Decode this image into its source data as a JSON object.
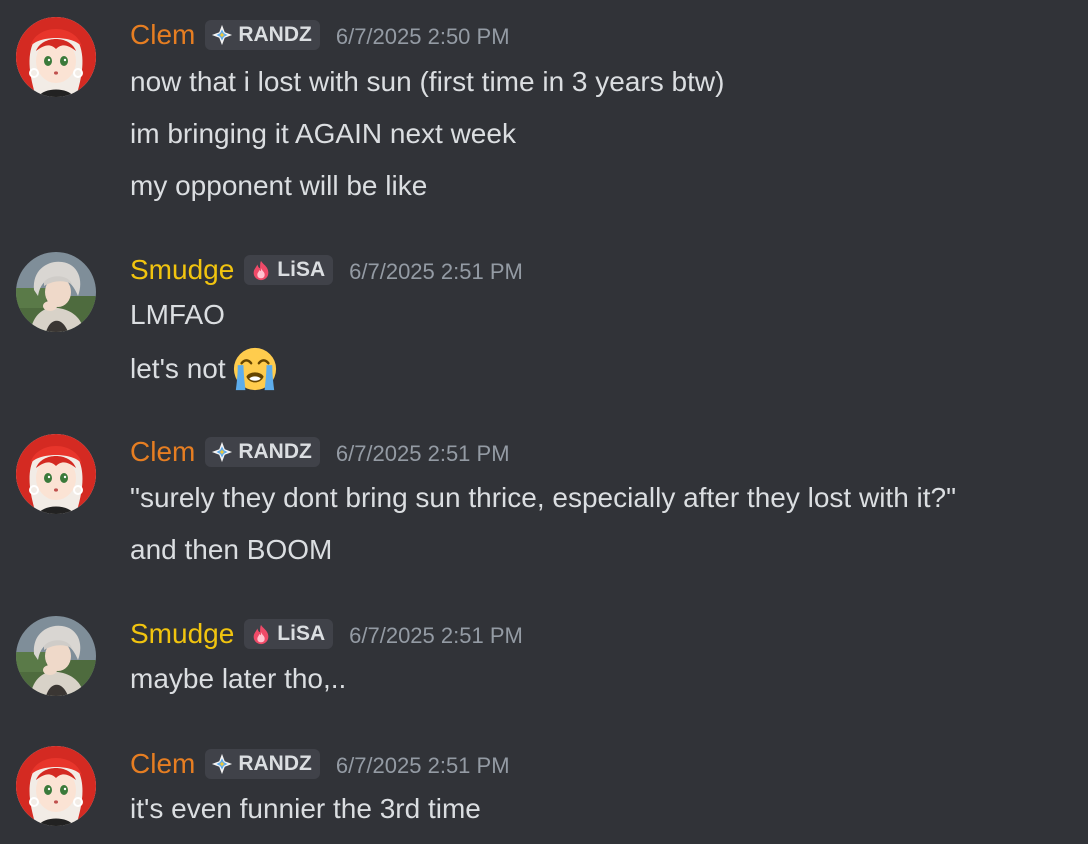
{
  "colors": {
    "background": "#313338",
    "clem_name": "#e67e22",
    "smudge_name": "#f1c40f",
    "text": "#dbdee1",
    "timestamp": "#949ba4",
    "tag_bg": "#404249"
  },
  "messages": [
    {
      "author": "Clem",
      "tag": "RANDZ",
      "tag_icon": "diamond-sparkle-icon",
      "timestamp": "6/7/2025 2:50 PM",
      "lines": [
        "now that i lost with sun (first time in 3 years btw)",
        "im bringing it AGAIN next week",
        "my opponent will be like"
      ]
    },
    {
      "author": "Smudge",
      "tag": "LiSA",
      "tag_icon": "flame-icon",
      "timestamp": "6/7/2025 2:51 PM",
      "lines": [
        "LMFAO",
        "let's not"
      ],
      "emoji": "loudly-crying-face-emoji"
    },
    {
      "author": "Clem",
      "tag": "RANDZ",
      "tag_icon": "diamond-sparkle-icon",
      "timestamp": "6/7/2025 2:51 PM",
      "lines": [
        "\"surely they dont bring sun thrice, especially after they lost with it?\"",
        "and then BOOM"
      ]
    },
    {
      "author": "Smudge",
      "tag": "LiSA",
      "tag_icon": "flame-icon",
      "timestamp": "6/7/2025 2:51 PM",
      "lines": [
        "maybe later tho,.."
      ]
    },
    {
      "author": "Clem",
      "tag": "RANDZ",
      "tag_icon": "diamond-sparkle-icon",
      "timestamp": "6/7/2025 2:51 PM",
      "lines": [
        "it's even funnier the 3rd time"
      ]
    }
  ]
}
